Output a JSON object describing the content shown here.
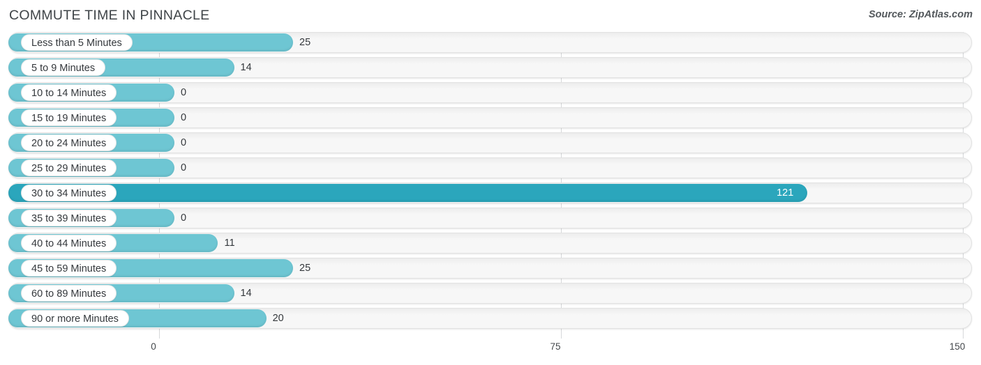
{
  "header": {
    "title": "COMMUTE TIME IN PINNACLE",
    "source": "Source: ZipAtlas.com"
  },
  "colors": {
    "bar": "#6ec6d3",
    "bar_highlight": "#2ba6bc",
    "track": "#f7f7f7",
    "gridline": "#d6d8da",
    "text": "#34383c"
  },
  "chart_data": {
    "type": "bar",
    "orientation": "horizontal",
    "title": "COMMUTE TIME IN PINNACLE",
    "xlabel": "",
    "ylabel": "",
    "xlim": [
      0,
      150
    ],
    "xticks": [
      0,
      75,
      150
    ],
    "xtick_labels": [
      "0",
      "75",
      "150"
    ],
    "grid": true,
    "legend": null,
    "categories": [
      "Less than 5 Minutes",
      "5 to 9 Minutes",
      "10 to 14 Minutes",
      "15 to 19 Minutes",
      "20 to 24 Minutes",
      "25 to 29 Minutes",
      "30 to 34 Minutes",
      "35 to 39 Minutes",
      "40 to 44 Minutes",
      "45 to 59 Minutes",
      "60 to 89 Minutes",
      "90 or more Minutes"
    ],
    "values": [
      25,
      14,
      0,
      0,
      0,
      0,
      121,
      0,
      11,
      25,
      14,
      20
    ],
    "value_labels": [
      "25",
      "14",
      "0",
      "0",
      "0",
      "0",
      "121",
      "0",
      "11",
      "25",
      "14",
      "20"
    ],
    "highlight_index": 6
  },
  "rows": [
    {
      "label": "Less than 5 Minutes",
      "value": 25,
      "value_label": "25",
      "highlight": false
    },
    {
      "label": "5 to 9 Minutes",
      "value": 14,
      "value_label": "14",
      "highlight": false
    },
    {
      "label": "10 to 14 Minutes",
      "value": 0,
      "value_label": "0",
      "highlight": false
    },
    {
      "label": "15 to 19 Minutes",
      "value": 0,
      "value_label": "0",
      "highlight": false
    },
    {
      "label": "20 to 24 Minutes",
      "value": 0,
      "value_label": "0",
      "highlight": false
    },
    {
      "label": "25 to 29 Minutes",
      "value": 0,
      "value_label": "0",
      "highlight": false
    },
    {
      "label": "30 to 34 Minutes",
      "value": 121,
      "value_label": "121",
      "highlight": true
    },
    {
      "label": "35 to 39 Minutes",
      "value": 0,
      "value_label": "0",
      "highlight": false
    },
    {
      "label": "40 to 44 Minutes",
      "value": 11,
      "value_label": "11",
      "highlight": false
    },
    {
      "label": "45 to 59 Minutes",
      "value": 25,
      "value_label": "25",
      "highlight": false
    },
    {
      "label": "60 to 89 Minutes",
      "value": 14,
      "value_label": "14",
      "highlight": false
    },
    {
      "label": "90 or more Minutes",
      "value": 20,
      "value_label": "20",
      "highlight": false
    }
  ],
  "axis": {
    "ticks": [
      {
        "label": "0",
        "value": 0
      },
      {
        "label": "75",
        "value": 75
      },
      {
        "label": "150",
        "value": 150
      }
    ]
  }
}
